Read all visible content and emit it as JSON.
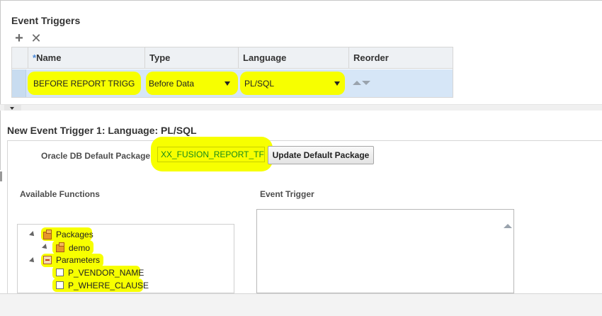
{
  "section_title": "Event Triggers",
  "toolbar": {
    "add_symbol": "+",
    "delete_symbol": "✕"
  },
  "grid": {
    "headers": {
      "name_required": "*",
      "name": "Name",
      "type": "Type",
      "language": "Language",
      "reorder": "Reorder"
    },
    "rows": [
      {
        "name": "BEFORE REPORT TRIGG",
        "type": "Before Data",
        "language": "PL/SQL"
      }
    ]
  },
  "detail": {
    "title": "New Event Trigger 1: Language: PL/SQL",
    "package_label": "Oracle DB Default Package",
    "package_value": "XX_FUSION_REPORT_TF",
    "update_button": "Update Default Package",
    "available_functions_label": "Available Functions",
    "event_trigger_label": "Event Trigger",
    "tree": [
      {
        "label": "Packages",
        "icon": "package-icon",
        "children": [
          {
            "label": "demo",
            "icon": "package-icon"
          }
        ]
      },
      {
        "label": "Parameters",
        "icon": "parameters-icon",
        "children": [
          {
            "label": "P_VENDOR_NAME",
            "icon": "parameter-icon"
          },
          {
            "label": "P_WHERE_CLAUSE",
            "icon": "parameter-icon"
          }
        ]
      }
    ]
  },
  "colors": {
    "highlight": "#f7ff00",
    "selected_row": "#d6e6f7",
    "header_bg": "#eef1f4",
    "package_text": "#1a8a1a"
  }
}
